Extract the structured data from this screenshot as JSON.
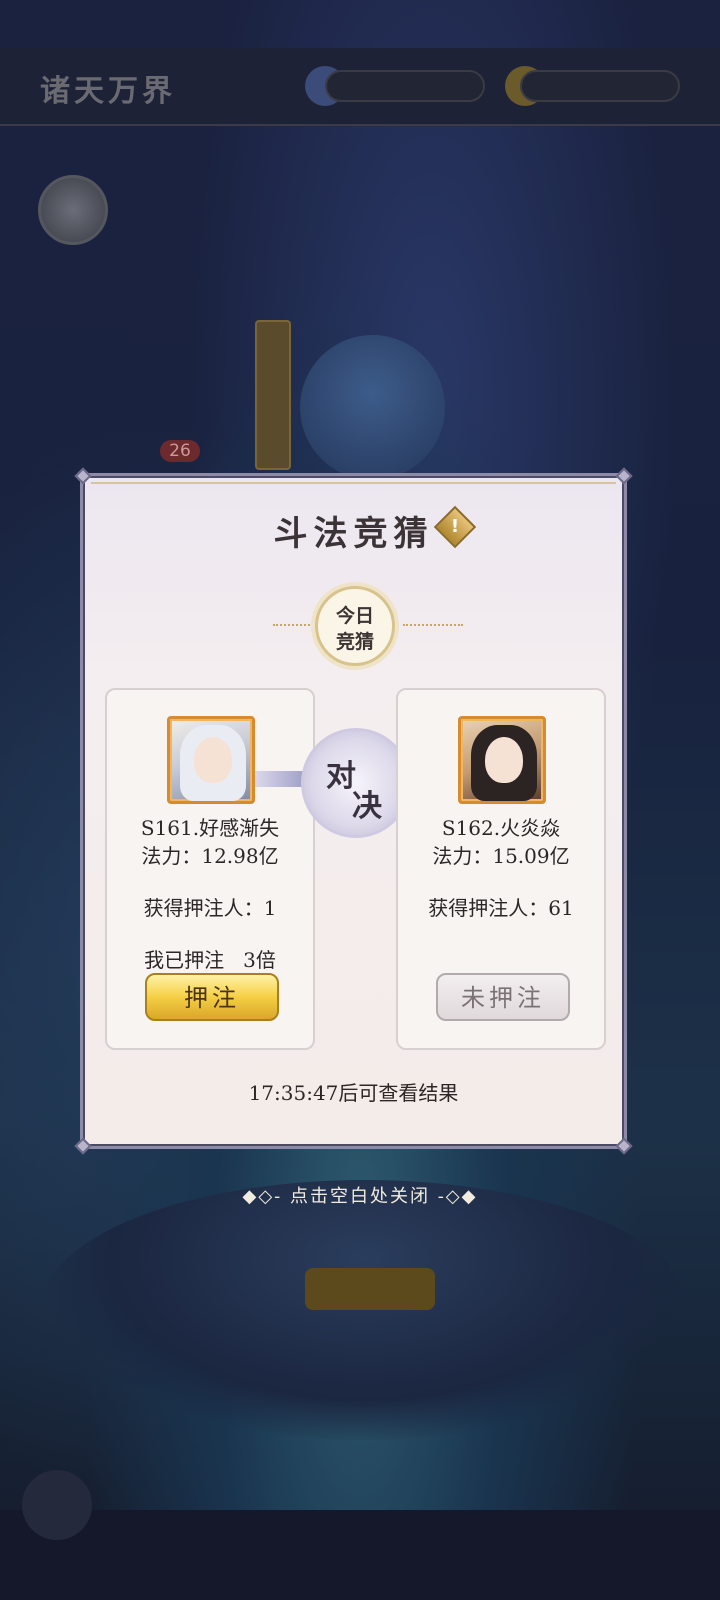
{
  "background": {
    "badge_count": "26"
  },
  "dialog": {
    "title": "斗法竞猜",
    "today_badge": [
      "今日",
      "竞猜"
    ],
    "vs_text": [
      "对",
      "决"
    ],
    "left": {
      "name": "S161.好感渐失",
      "power": "法力：12.98亿",
      "bettors": "获得押注人：1",
      "my_bet": "我已押注   3倍",
      "button_label": "押注",
      "button_state": "active"
    },
    "right": {
      "name": "S162.火炎焱",
      "power": "法力：15.09亿",
      "bettors": "获得押注人：61",
      "button_label": "未押注",
      "button_state": "disabled"
    },
    "result_time": "17:35:47后可查看结果"
  },
  "close_hint": "◆◇- 点击空白处关闭 -◇◆",
  "colors": {
    "accent_gold": "#f5cf45",
    "portrait_frame": "#d88a2e",
    "dialog_bg": "#f3ece8"
  }
}
